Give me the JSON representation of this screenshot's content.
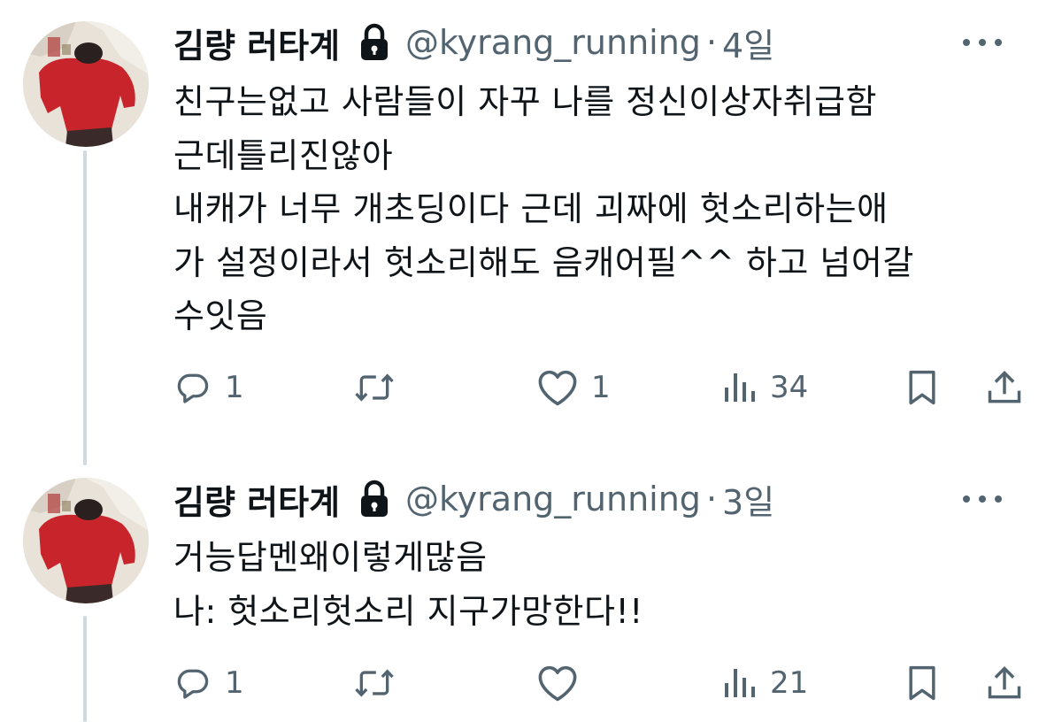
{
  "tweets": [
    {
      "author": {
        "display_name": "김량 러타계",
        "handle": "@kyrang_running",
        "avatar_icon": "profile-photo",
        "protected_icon": "lock-icon"
      },
      "separator": "·",
      "time": "4일",
      "text": "친구는없고 사람들이 자꾸 나를 정신이상자취급함\n근데틀리진않아\n내캐가 너무 개초딩이다 근데 괴짜에 헛소리하는애\n가 설정이라서 헛소리해도 음캐어필^^ 하고 넘어갈\n수잇음",
      "actions": {
        "reply_count": "1",
        "retweet_count": "",
        "like_count": "1",
        "view_count": "34"
      }
    },
    {
      "author": {
        "display_name": "김량 러타계",
        "handle": "@kyrang_running",
        "avatar_icon": "profile-photo",
        "protected_icon": "lock-icon"
      },
      "separator": "·",
      "time": "3일",
      "text": "거능답멘왜이렇게많음\n나: 헛소리헛소리 지구가망한다!!",
      "actions": {
        "reply_count": "1",
        "retweet_count": "",
        "like_count": "",
        "view_count": "21"
      }
    }
  ],
  "colors": {
    "text_primary": "#0f1419",
    "text_secondary": "#536471",
    "thread_line": "#cfd9de",
    "background": "#ffffff"
  }
}
